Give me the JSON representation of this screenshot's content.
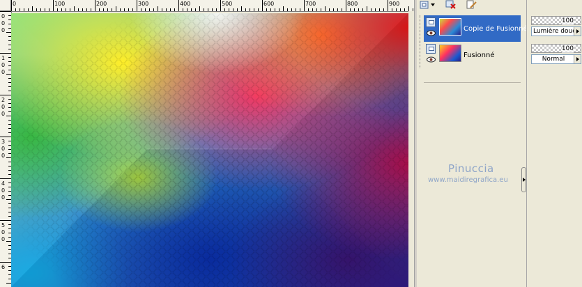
{
  "ruler_top": {
    "labels": [
      "0",
      "100",
      "200",
      "300",
      "400",
      "500",
      "600",
      "700",
      "800",
      "900"
    ]
  },
  "ruler_left": {
    "labels": [
      "0",
      "0",
      "0",
      "1",
      "0",
      "0",
      "2",
      "0",
      "0",
      "3",
      "0",
      "0",
      "4",
      "0",
      "0",
      "5",
      "0",
      "0",
      "6"
    ]
  },
  "layers": [
    {
      "name": "Copie de Fusionné",
      "selected": true,
      "opacity": "100",
      "blend_mode": "Lumière douce"
    },
    {
      "name": "Fusionné",
      "selected": false,
      "opacity": "100",
      "blend_mode": "Normal"
    }
  ],
  "watermark": {
    "name": "Pinuccia",
    "url": "www.maidiregrafica.eu"
  },
  "icons": {
    "toolbar": [
      "new-layer-icon",
      "dropdown-arrow-icon",
      "delete-layer-icon",
      "edit-layer-icon"
    ],
    "layer_row": [
      "raster-layer-icon",
      "visibility-eye-icon"
    ]
  },
  "colors": {
    "selection": "#316ac5",
    "panel_bg": "#ece9d8",
    "watermark": "#8da4c8"
  }
}
